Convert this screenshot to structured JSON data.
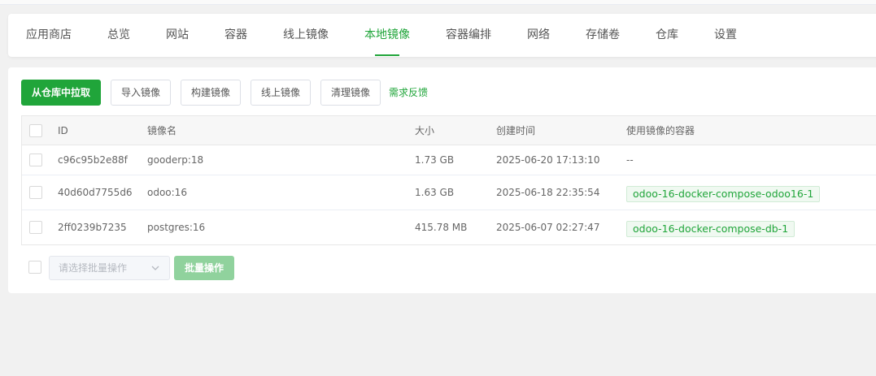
{
  "nav": {
    "tabs": [
      {
        "label": "应用商店"
      },
      {
        "label": "总览"
      },
      {
        "label": "网站"
      },
      {
        "label": "容器"
      },
      {
        "label": "线上镜像"
      },
      {
        "label": "本地镜像"
      },
      {
        "label": "容器编排"
      },
      {
        "label": "网络"
      },
      {
        "label": "存储卷"
      },
      {
        "label": "仓库"
      },
      {
        "label": "设置"
      }
    ],
    "active_tab": "本地镜像"
  },
  "toolbar": {
    "pull_label": "从仓库中拉取",
    "import_label": "导入镜像",
    "build_label": "构建镜像",
    "online_label": "线上镜像",
    "clean_label": "清理镜像",
    "feedback_label": "需求反馈"
  },
  "table": {
    "headers": {
      "id": "ID",
      "name": "镜像名",
      "size": "大小",
      "created": "创建时间",
      "containers": "使用镜像的容器"
    },
    "rows": [
      {
        "id": "c96c95b2e88f",
        "name": "gooderp:18",
        "size": "1.73 GB",
        "created": "2025-06-20 17:13:10",
        "containers": "--"
      },
      {
        "id": "40d60d7755d6",
        "name": "odoo:16",
        "size": "1.63 GB",
        "created": "2025-06-18 22:35:54",
        "containers": "odoo-16-docker-compose-odoo16-1"
      },
      {
        "id": "2ff0239b7235",
        "name": "postgres:16",
        "size": "415.78 MB",
        "created": "2025-06-07 02:27:47",
        "containers": "odoo-16-docker-compose-db-1"
      }
    ]
  },
  "batch": {
    "placeholder": "请选择批量操作",
    "button_label": "批量操作"
  },
  "colors": {
    "accent": "#20a53a",
    "accent_disabled": "#90d29d"
  }
}
